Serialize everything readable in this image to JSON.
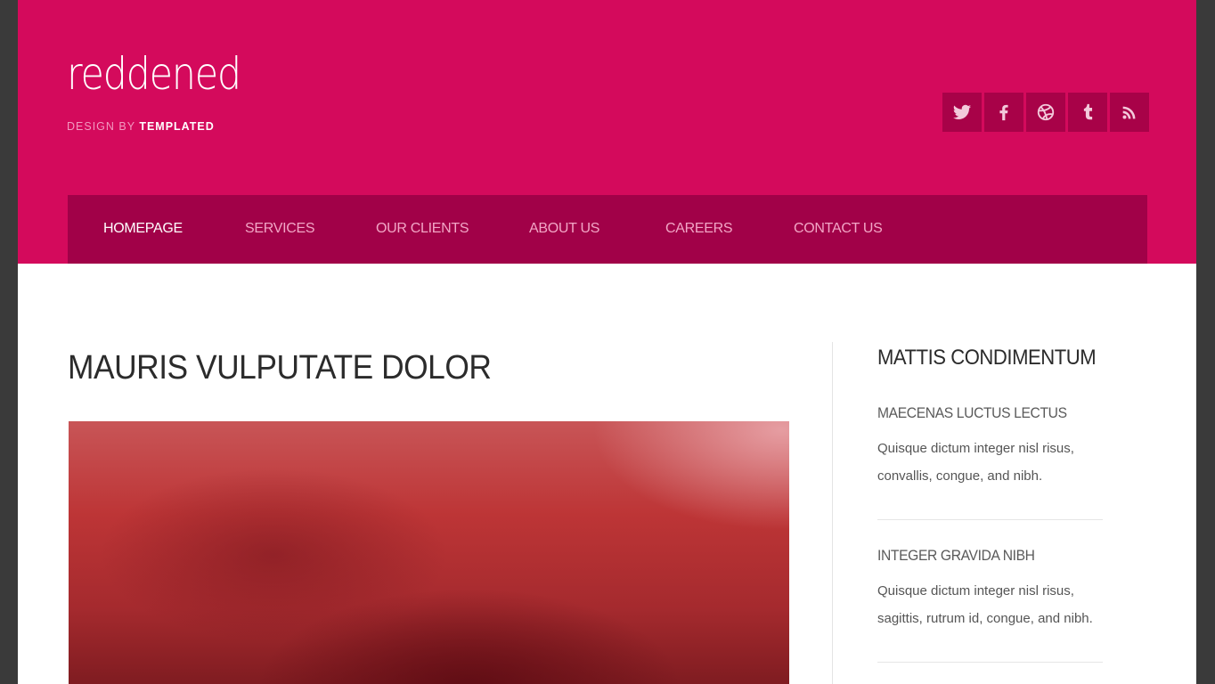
{
  "site": {
    "logo": "reddened",
    "byline_prefix": "DESIGN BY ",
    "byline_brand": "TEMPLATED"
  },
  "social": [
    {
      "name": "twitter-icon"
    },
    {
      "name": "facebook-icon"
    },
    {
      "name": "dribbble-icon"
    },
    {
      "name": "tumblr-icon"
    },
    {
      "name": "rss-icon"
    }
  ],
  "nav": {
    "items": [
      {
        "label": "HOMEPAGE",
        "active": true
      },
      {
        "label": "SERVICES"
      },
      {
        "label": "OUR CLIENTS"
      },
      {
        "label": "ABOUT US"
      },
      {
        "label": "CAREERS"
      },
      {
        "label": "CONTACT US"
      }
    ]
  },
  "main": {
    "title": "MAURIS VULPUTATE DOLOR"
  },
  "sidebar": {
    "title": "MATTIS CONDIMENTUM",
    "items": [
      {
        "title": "MAECENAS LUCTUS LECTUS",
        "text": "Quisque dictum integer nisl risus, convallis, congue, and nibh."
      },
      {
        "title": "INTEGER GRAVIDA NIBH",
        "text": "Quisque dictum integer nisl risus, sagittis, rutrum id, congue, and nibh."
      }
    ]
  },
  "colors": {
    "header": "#d40a5c",
    "nav": "#a10148",
    "social_bg": "#a80248",
    "text_dark": "#2b2b2b"
  }
}
